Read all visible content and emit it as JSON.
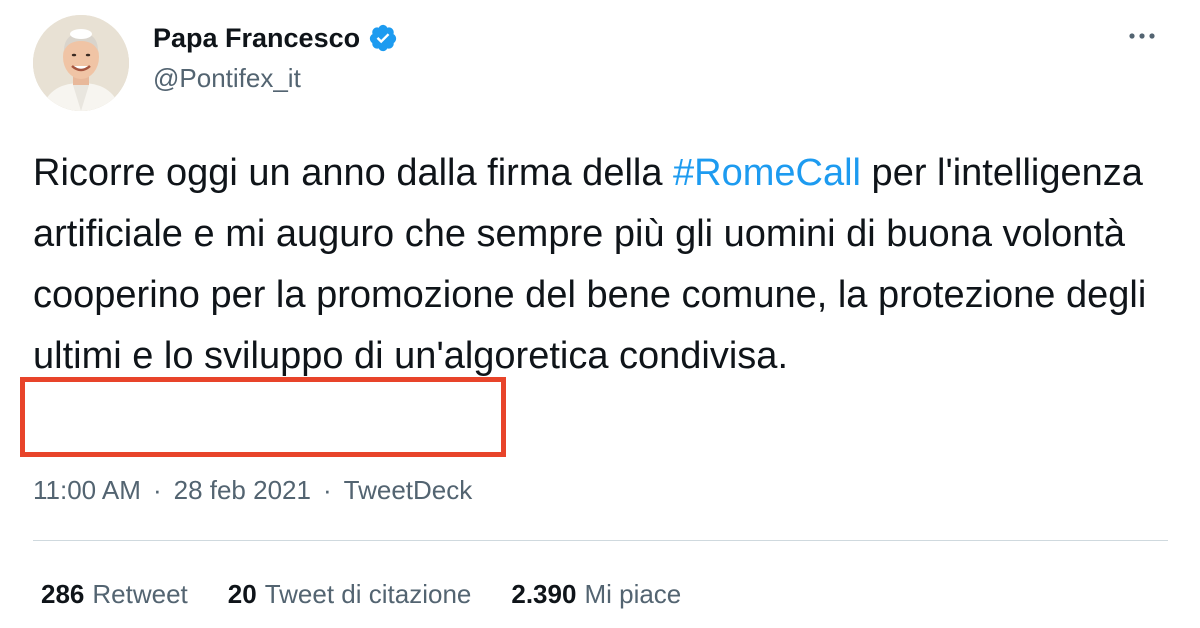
{
  "author": {
    "display_name": "Papa Francesco",
    "handle": "@Pontifex_it",
    "verified": true
  },
  "tweet": {
    "text_before": "Ricorre oggi un anno dalla firma della ",
    "hashtag": "#RomeCall",
    "text_middle": " per l'intelligenza artificiale e mi auguro che sempre più gli uomini di buona volontà cooperino per la promozione del bene comune, la protezione degli ultimi e lo sviluppo di ",
    "text_highlighted": "un'algoretica condivisa."
  },
  "meta": {
    "time": "11:00 AM",
    "separator": "·",
    "date": "28 feb 2021",
    "source": "TweetDeck"
  },
  "stats": [
    {
      "count": "286",
      "label": "Retweet"
    },
    {
      "count": "20",
      "label": "Tweet di citazione"
    },
    {
      "count": "2.390",
      "label": "Mi piace"
    }
  ],
  "colors": {
    "hashtag": "#1d9bf0",
    "verified": "#1d9bf0",
    "highlight_border": "#e8442a",
    "secondary_text": "#536471"
  },
  "icons": {
    "verified": "verified-badge-icon",
    "more": "more-options-icon"
  }
}
